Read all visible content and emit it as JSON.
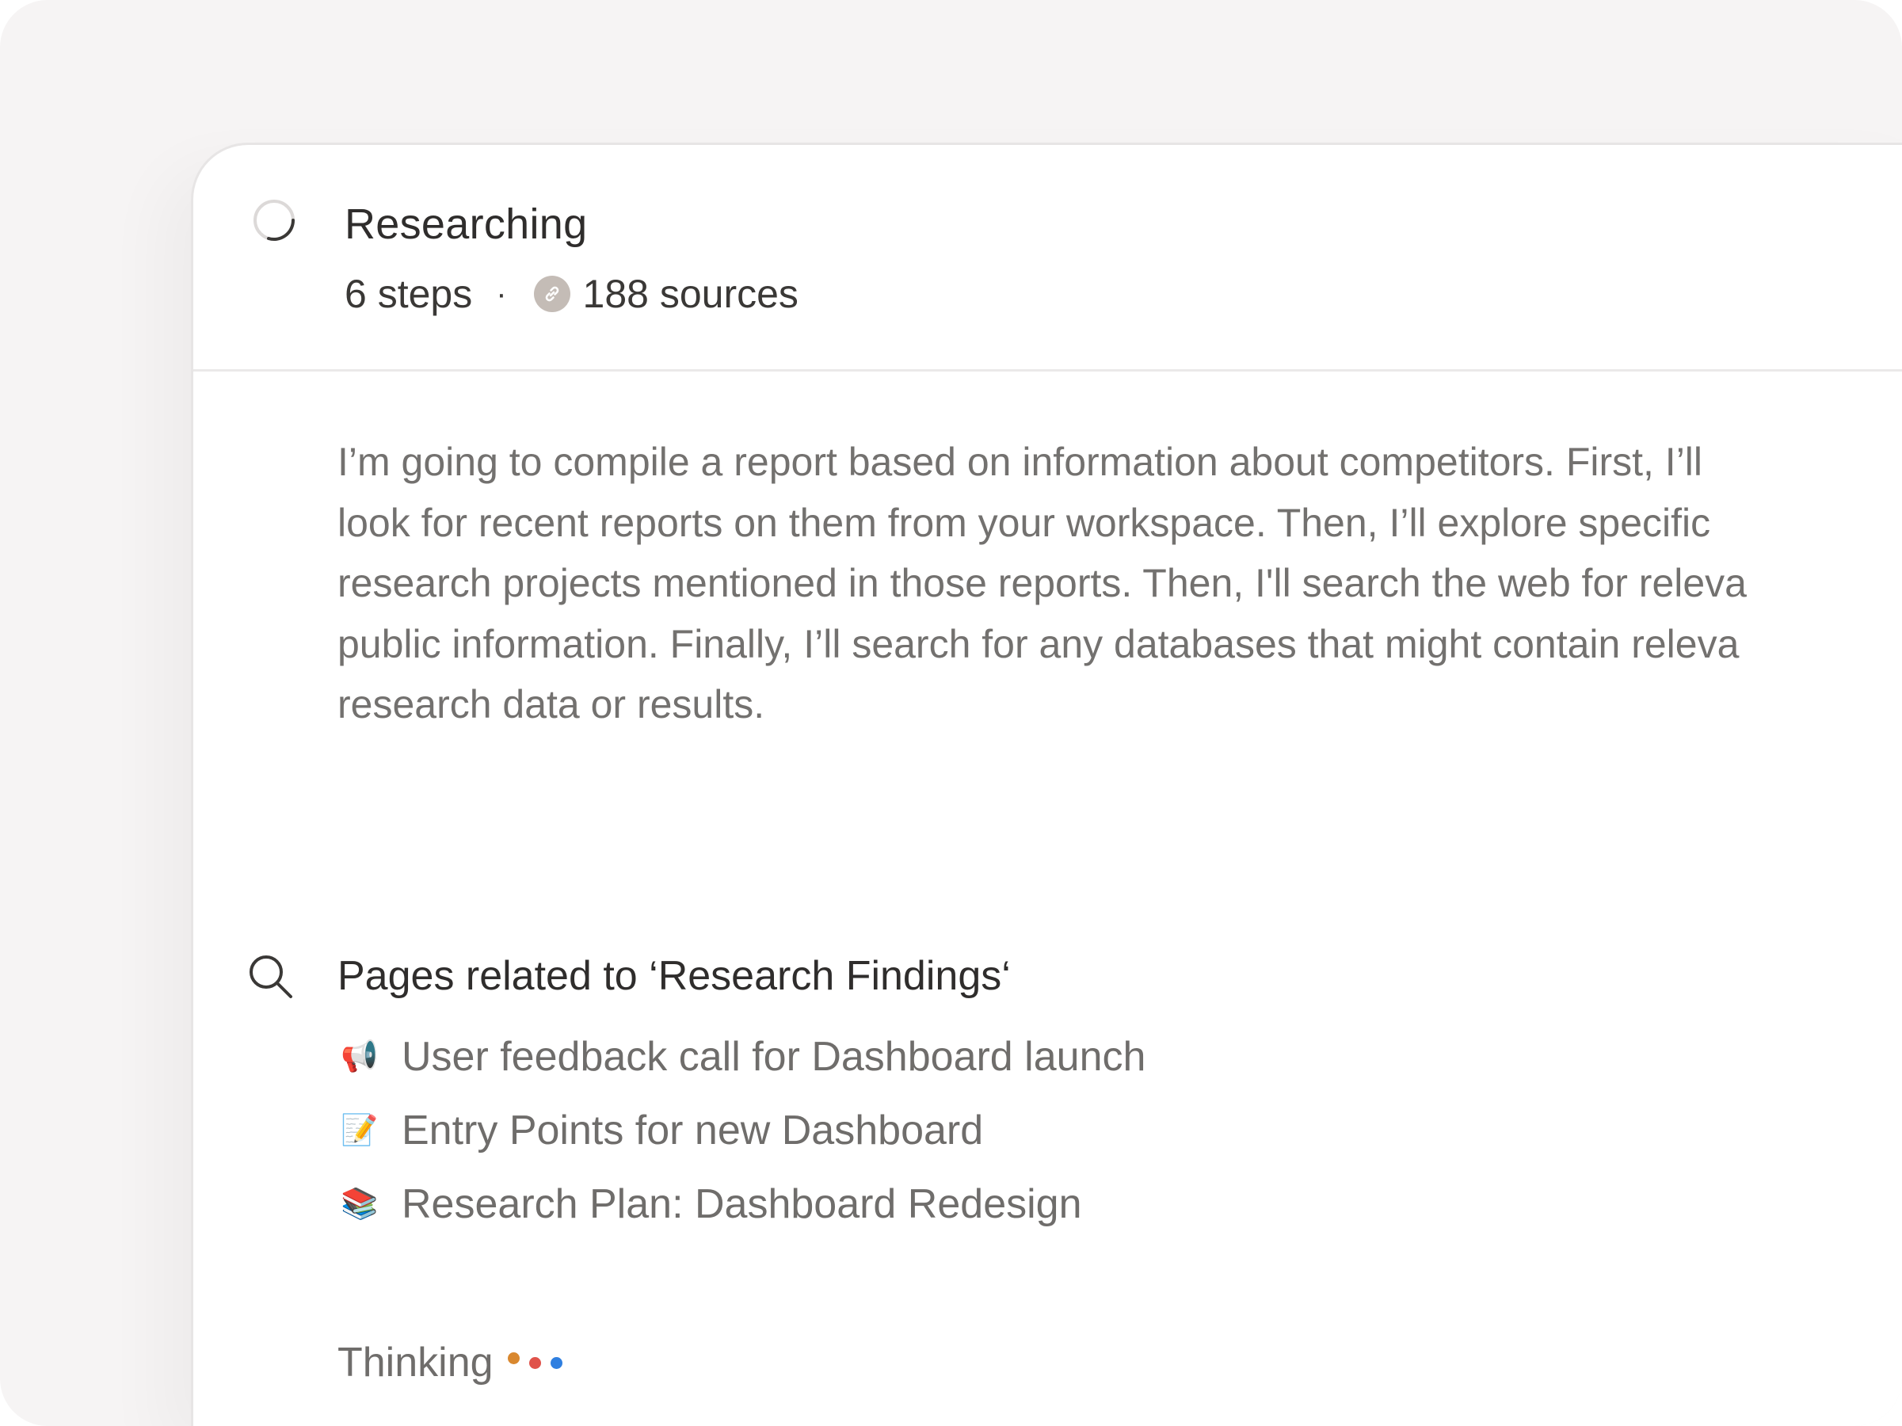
{
  "research": {
    "status_title": "Researching",
    "steps_label": "6 steps",
    "separator": "·",
    "sources_label": "188 sources",
    "summary_lines": [
      "I’m going to compile a report based on information about competitors. First, I’ll",
      "look for recent reports on them from your workspace. Then, I’ll explore specific",
      "research projects mentioned in those reports. Then, I'll search the web for releva",
      "public information. Finally, I’ll search for any databases that might contain releva",
      "research data or results."
    ]
  },
  "search": {
    "icon": "search-icon",
    "title": "Pages related to ‘Research Findings‘",
    "pages": [
      {
        "emoji": "📢",
        "icon": "megaphone-icon",
        "label": "User feedback call for Dashboard launch"
      },
      {
        "emoji": "📝",
        "icon": "memo-icon",
        "label": "Entry Points for new Dashboard"
      },
      {
        "emoji": "📚",
        "icon": "books-icon",
        "label": "Research Plan: Dashboard Redesign"
      }
    ]
  },
  "thinking": {
    "label": "Thinking",
    "dot_colors": [
      "#d9882f",
      "#e0524a",
      "#2f7fe0"
    ]
  },
  "colors": {
    "background": "#f6f4f4",
    "panel": "#ffffff",
    "title_text": "#2f2d2c",
    "body_text": "#73716f",
    "link_badge": "#c4bcb6"
  }
}
